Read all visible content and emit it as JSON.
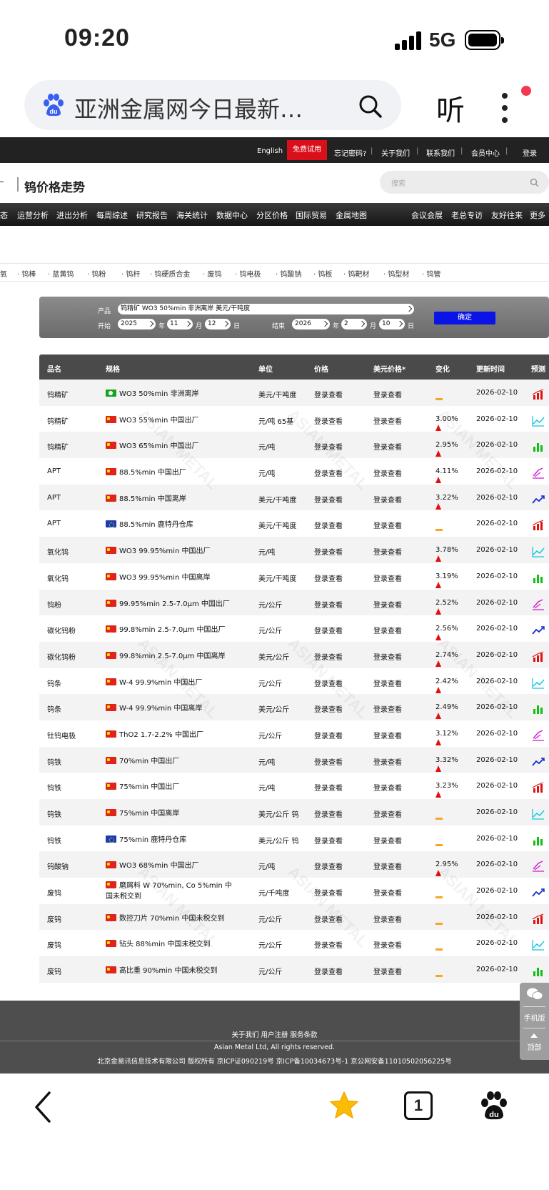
{
  "status_bar": {
    "time": "09:20",
    "network": "5G"
  },
  "browser": {
    "search_text": "亚洲金属网今日最新…",
    "listen_label": "听",
    "tab_count": "1"
  },
  "site": {
    "topbar": [
      {
        "label": "English"
      },
      {
        "label": "免费试用"
      },
      {
        "label": "忘记密码?"
      },
      {
        "label": "关于我们"
      },
      {
        "label": "联系我们"
      },
      {
        "label": "会员中心"
      },
      {
        "label": "登录"
      }
    ],
    "page_title": "钨价格走势",
    "search_placeholder": "搜索",
    "nav": [
      "态",
      "运营分析",
      "进出分析",
      "每周综述",
      "研究报告",
      "海关统计",
      "数据中心",
      "分区价格",
      "国际贸易",
      "金属地图",
      "会议会展",
      "老总专访",
      "友好往来",
      "更多"
    ],
    "categories": [
      "氧",
      "· 钨棒",
      "· 蓝黄钨",
      "· 钨粉",
      "· 钨杆",
      "· 钨硬质合金",
      "· 废钨",
      "· 钨电极",
      "· 钨酸钠",
      "· 钨板",
      "· 钨靶材",
      "· 钨型材",
      "· 钨管"
    ]
  },
  "filter": {
    "product_label": "产品",
    "product_value": "钨精矿 WO3 50%min 非洲离岸 美元/干吨度",
    "start_label": "开始",
    "end_label": "结束",
    "start_year": "2025",
    "start_month": "11",
    "start_day": "12",
    "end_year": "2026",
    "end_month": "2",
    "end_day": "10",
    "year_unit": "年",
    "month_unit": "月",
    "day_unit": "日",
    "confirm_label": "确定"
  },
  "table": {
    "headers": [
      "品名",
      "规格",
      "单位",
      "价格",
      "美元价格*",
      "变化",
      "更新时间",
      "预测"
    ],
    "rows": [
      {
        "name": "钨精矿",
        "flag": "af",
        "spec": "WO3 50%min 非洲离岸",
        "unit": "美元/干吨度",
        "price": "登录查看",
        "usd": "登录查看",
        "change": "",
        "dir": "flat",
        "date": "2026-02-10",
        "pred": "bar-red"
      },
      {
        "name": "钨精矿",
        "flag": "cn",
        "spec": "WO3 55%min 中国出厂",
        "unit": "元/吨 65基",
        "price": "登录查看",
        "usd": "登录查看",
        "change": "3.00%",
        "dir": "up",
        "date": "2026-02-10",
        "pred": "line-cyan"
      },
      {
        "name": "钨精矿",
        "flag": "cn",
        "spec": "WO3 65%min 中国出厂",
        "unit": "元/吨",
        "price": "登录查看",
        "usd": "登录查看",
        "change": "2.95%",
        "dir": "up",
        "date": "2026-02-10",
        "pred": "bar-green"
      },
      {
        "name": "APT",
        "flag": "cn",
        "spec": "88.5%min 中国出厂",
        "unit": "元/吨",
        "price": "登录查看",
        "usd": "登录查看",
        "change": "4.11%",
        "dir": "up",
        "date": "2026-02-10",
        "pred": "line-pink"
      },
      {
        "name": "APT",
        "flag": "cn",
        "spec": "88.5%min 中国离岸",
        "unit": "美元/干吨度",
        "price": "登录查看",
        "usd": "登录查看",
        "change": "3.22%",
        "dir": "up",
        "date": "2026-02-10",
        "pred": "line-blue"
      },
      {
        "name": "APT",
        "flag": "eu",
        "spec": "88.5%min 鹿特丹仓库",
        "unit": "美元/干吨度",
        "price": "登录查看",
        "usd": "登录查看",
        "change": "",
        "dir": "flat",
        "date": "2026-02-10",
        "pred": "bar-red"
      },
      {
        "name": "氧化钨",
        "flag": "cn",
        "spec": "WO3 99.95%min 中国出厂",
        "unit": "元/吨",
        "price": "登录查看",
        "usd": "登录查看",
        "change": "3.78%",
        "dir": "up",
        "date": "2026-02-10",
        "pred": "line-cyan"
      },
      {
        "name": "氧化钨",
        "flag": "cn",
        "spec": "WO3 99.95%min 中国离岸",
        "unit": "美元/干吨度",
        "price": "登录查看",
        "usd": "登录查看",
        "change": "3.19%",
        "dir": "up",
        "date": "2026-02-10",
        "pred": "bar-green"
      },
      {
        "name": "钨粉",
        "flag": "cn",
        "spec": "99.95%min 2.5-7.0μm 中国出厂",
        "unit": "元/公斤",
        "price": "登录查看",
        "usd": "登录查看",
        "change": "2.52%",
        "dir": "up",
        "date": "2026-02-10",
        "pred": "line-pink"
      },
      {
        "name": "碳化钨粉",
        "flag": "cn",
        "spec": "99.8%min 2.5-7.0μm 中国出厂",
        "unit": "元/公斤",
        "price": "登录查看",
        "usd": "登录查看",
        "change": "2.56%",
        "dir": "up",
        "date": "2026-02-10",
        "pred": "line-blue"
      },
      {
        "name": "碳化钨粉",
        "flag": "cn",
        "spec": "99.8%min 2.5-7.0μm 中国离岸",
        "unit": "美元/公斤",
        "price": "登录查看",
        "usd": "登录查看",
        "change": "2.74%",
        "dir": "up",
        "date": "2026-02-10",
        "pred": "bar-red"
      },
      {
        "name": "钨条",
        "flag": "cn",
        "spec": "W-4 99.9%min 中国出厂",
        "unit": "元/公斤",
        "price": "登录查看",
        "usd": "登录查看",
        "change": "2.42%",
        "dir": "up",
        "date": "2026-02-10",
        "pred": "line-cyan"
      },
      {
        "name": "钨条",
        "flag": "cn",
        "spec": "W-4 99.9%min 中国离岸",
        "unit": "美元/公斤",
        "price": "登录查看",
        "usd": "登录查看",
        "change": "2.49%",
        "dir": "up",
        "date": "2026-02-10",
        "pred": "bar-green"
      },
      {
        "name": "钍钨电极",
        "flag": "cn",
        "spec": "ThO2 1.7-2.2% 中国出厂",
        "unit": "元/公斤",
        "price": "登录查看",
        "usd": "登录查看",
        "change": "3.12%",
        "dir": "up",
        "date": "2026-02-10",
        "pred": "line-pink"
      },
      {
        "name": "钨铁",
        "flag": "cn",
        "spec": "70%min 中国出厂",
        "unit": "元/吨",
        "price": "登录查看",
        "usd": "登录查看",
        "change": "3.32%",
        "dir": "up",
        "date": "2026-02-10",
        "pred": "line-blue"
      },
      {
        "name": "钨铁",
        "flag": "cn",
        "spec": "75%min 中国出厂",
        "unit": "元/吨",
        "price": "登录查看",
        "usd": "登录查看",
        "change": "3.23%",
        "dir": "up",
        "date": "2026-02-10",
        "pred": "bar-red"
      },
      {
        "name": "钨铁",
        "flag": "cn",
        "spec": "75%min 中国离岸",
        "unit": "美元/公斤 钨",
        "price": "登录查看",
        "usd": "登录查看",
        "change": "",
        "dir": "flat",
        "date": "2026-02-10",
        "pred": "line-cyan"
      },
      {
        "name": "钨铁",
        "flag": "eu",
        "spec": "75%min 鹿特丹仓库",
        "unit": "美元/公斤 钨",
        "price": "登录查看",
        "usd": "登录查看",
        "change": "",
        "dir": "flat",
        "date": "2026-02-10",
        "pred": "bar-green"
      },
      {
        "name": "钨酸钠",
        "flag": "cn",
        "spec": "WO3 68%min 中国出厂",
        "unit": "元/吨",
        "price": "登录查看",
        "usd": "登录查看",
        "change": "2.95%",
        "dir": "up",
        "date": "2026-02-10",
        "pred": "line-pink"
      },
      {
        "name": "废钨",
        "flag": "cn",
        "spec": "磨屑料 W 70%min, Co 5%min 中国未税交到",
        "unit": "元/千吨度",
        "price": "登录查看",
        "usd": "登录查看",
        "change": "",
        "dir": "flat",
        "date": "2026-02-10",
        "pred": "line-blue",
        "tall": true
      },
      {
        "name": "废钨",
        "flag": "cn",
        "spec": "数控刀片 70%min 中国未税交到",
        "unit": "元/公斤",
        "price": "登录查看",
        "usd": "登录查看",
        "change": "",
        "dir": "flat",
        "date": "2026-02-10",
        "pred": "bar-red"
      },
      {
        "name": "废钨",
        "flag": "cn",
        "spec": "钻头 88%min 中国未税交到",
        "unit": "元/公斤",
        "price": "登录查看",
        "usd": "登录查看",
        "change": "",
        "dir": "flat",
        "date": "2026-02-10",
        "pred": "line-cyan"
      },
      {
        "name": "废钨",
        "flag": "cn",
        "spec": "高比重 90%min 中国未税交到",
        "unit": "元/公斤",
        "price": "登录查看",
        "usd": "登录查看",
        "change": "",
        "dir": "flat",
        "date": "2026-02-10",
        "pred": "bar-green"
      }
    ]
  },
  "footer": {
    "links": "关于我们  用户注册  服务条款",
    "copyright": "Asian Metal Ltd, All rights reserved.",
    "company": "北京金易讯信息技术有限公司 版权所有 京ICP证090219号 京ICP备10034673号-1 京公网安备11010502056225号",
    "side_mobile": "手机版",
    "side_top": "顶部"
  },
  "watermark": "ASIAN METAL",
  "colors": {
    "accent_red": "#d9101b",
    "confirm_blue": "#0a14e6",
    "up_red": "#e01010",
    "flat_orange": "#f5a623"
  }
}
